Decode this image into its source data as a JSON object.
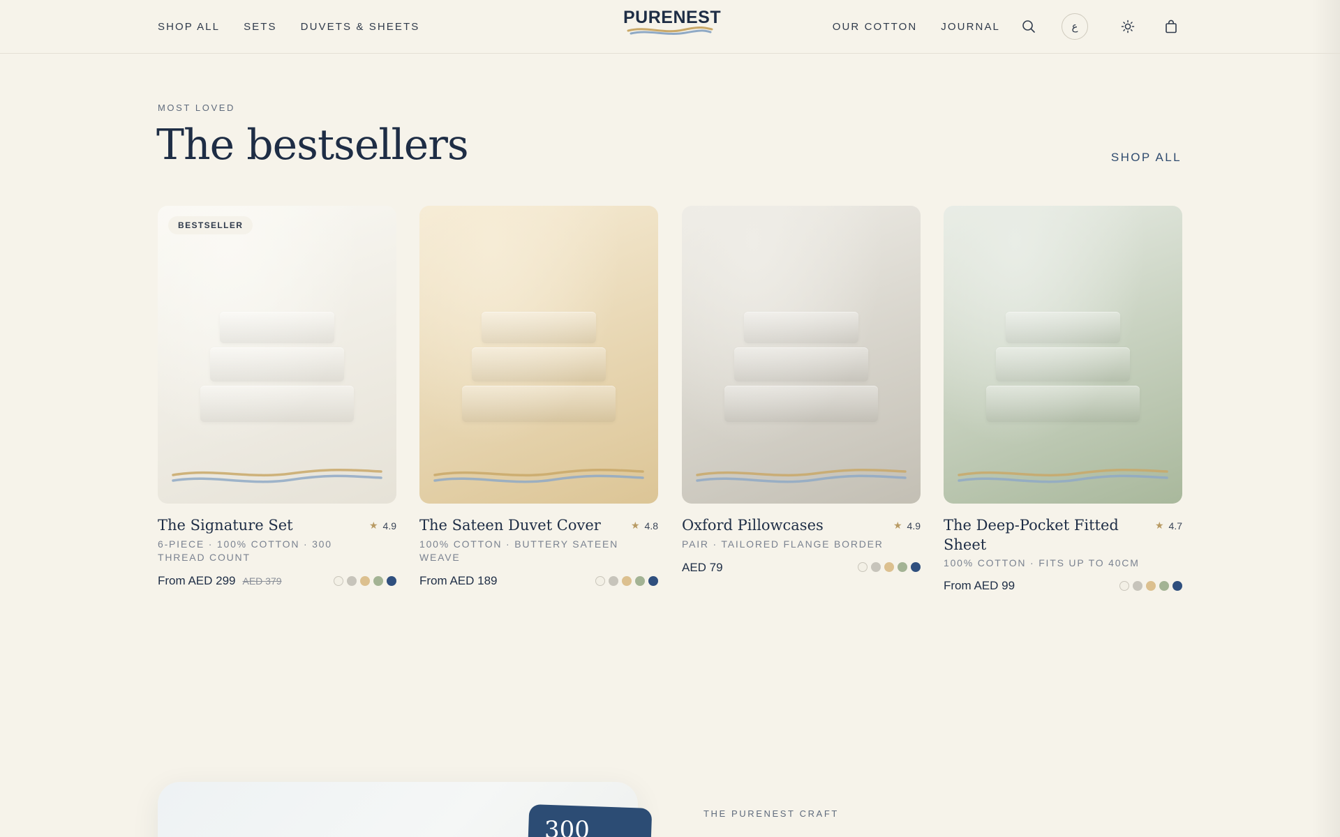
{
  "header": {
    "nav_left": [
      "SHOP ALL",
      "SETS",
      "DUVETS & SHEETS"
    ],
    "logo": "PURENEST",
    "nav_right": [
      "OUR COTTON",
      "JOURNAL"
    ],
    "language_label": "ع",
    "icons": [
      "search-icon",
      "sun-icon",
      "shopping-bag-icon"
    ]
  },
  "section": {
    "eyebrow": "MOST LOVED",
    "title": "The bestsellers",
    "shop_all": "SHOP ALL"
  },
  "products": [
    {
      "badge": "BESTSELLER",
      "name": "The Signature Set",
      "rating": "4.9",
      "desc": "6-PIECE · 100% COTTON · 300 THREAD COUNT",
      "price": "From AED 299",
      "old_price": "AED 379",
      "theme": [
        "#faf9f4",
        "#e6e2d7"
      ]
    },
    {
      "name": "The Sateen Duvet Cover",
      "rating": "4.8",
      "desc": "100% COTTON · BUTTERY SATEEN WEAVE",
      "price": "From AED 189",
      "theme": [
        "#f6ecd6",
        "#dcc596"
      ]
    },
    {
      "name": "Oxford Pillowcases",
      "rating": "4.9",
      "desc": "PAIR · TAILORED FLANGE BORDER",
      "price": "AED 79",
      "theme": [
        "#efede7",
        "#c3bfb4"
      ]
    },
    {
      "name": "The Deep-Pocket Fitted Sheet",
      "rating": "4.7",
      "desc": "100% COTTON · FITS UP TO 40CM",
      "price": "From AED 99",
      "theme": [
        "#e9ede6",
        "#a9b89c"
      ]
    }
  ],
  "swatch_colors": [
    "#f3f0e6",
    "#c7c4bb",
    "#dcc08f",
    "#a3b394",
    "#2f4f7e"
  ],
  "brand_colors": {
    "navy": "#1e2d45",
    "sand": "#c9a868",
    "blue_wave": "#8fa9c5",
    "background": "#f6f3ea"
  },
  "craft": {
    "stat": "300",
    "eyebrow": "THE PURENEST CRAFT"
  }
}
